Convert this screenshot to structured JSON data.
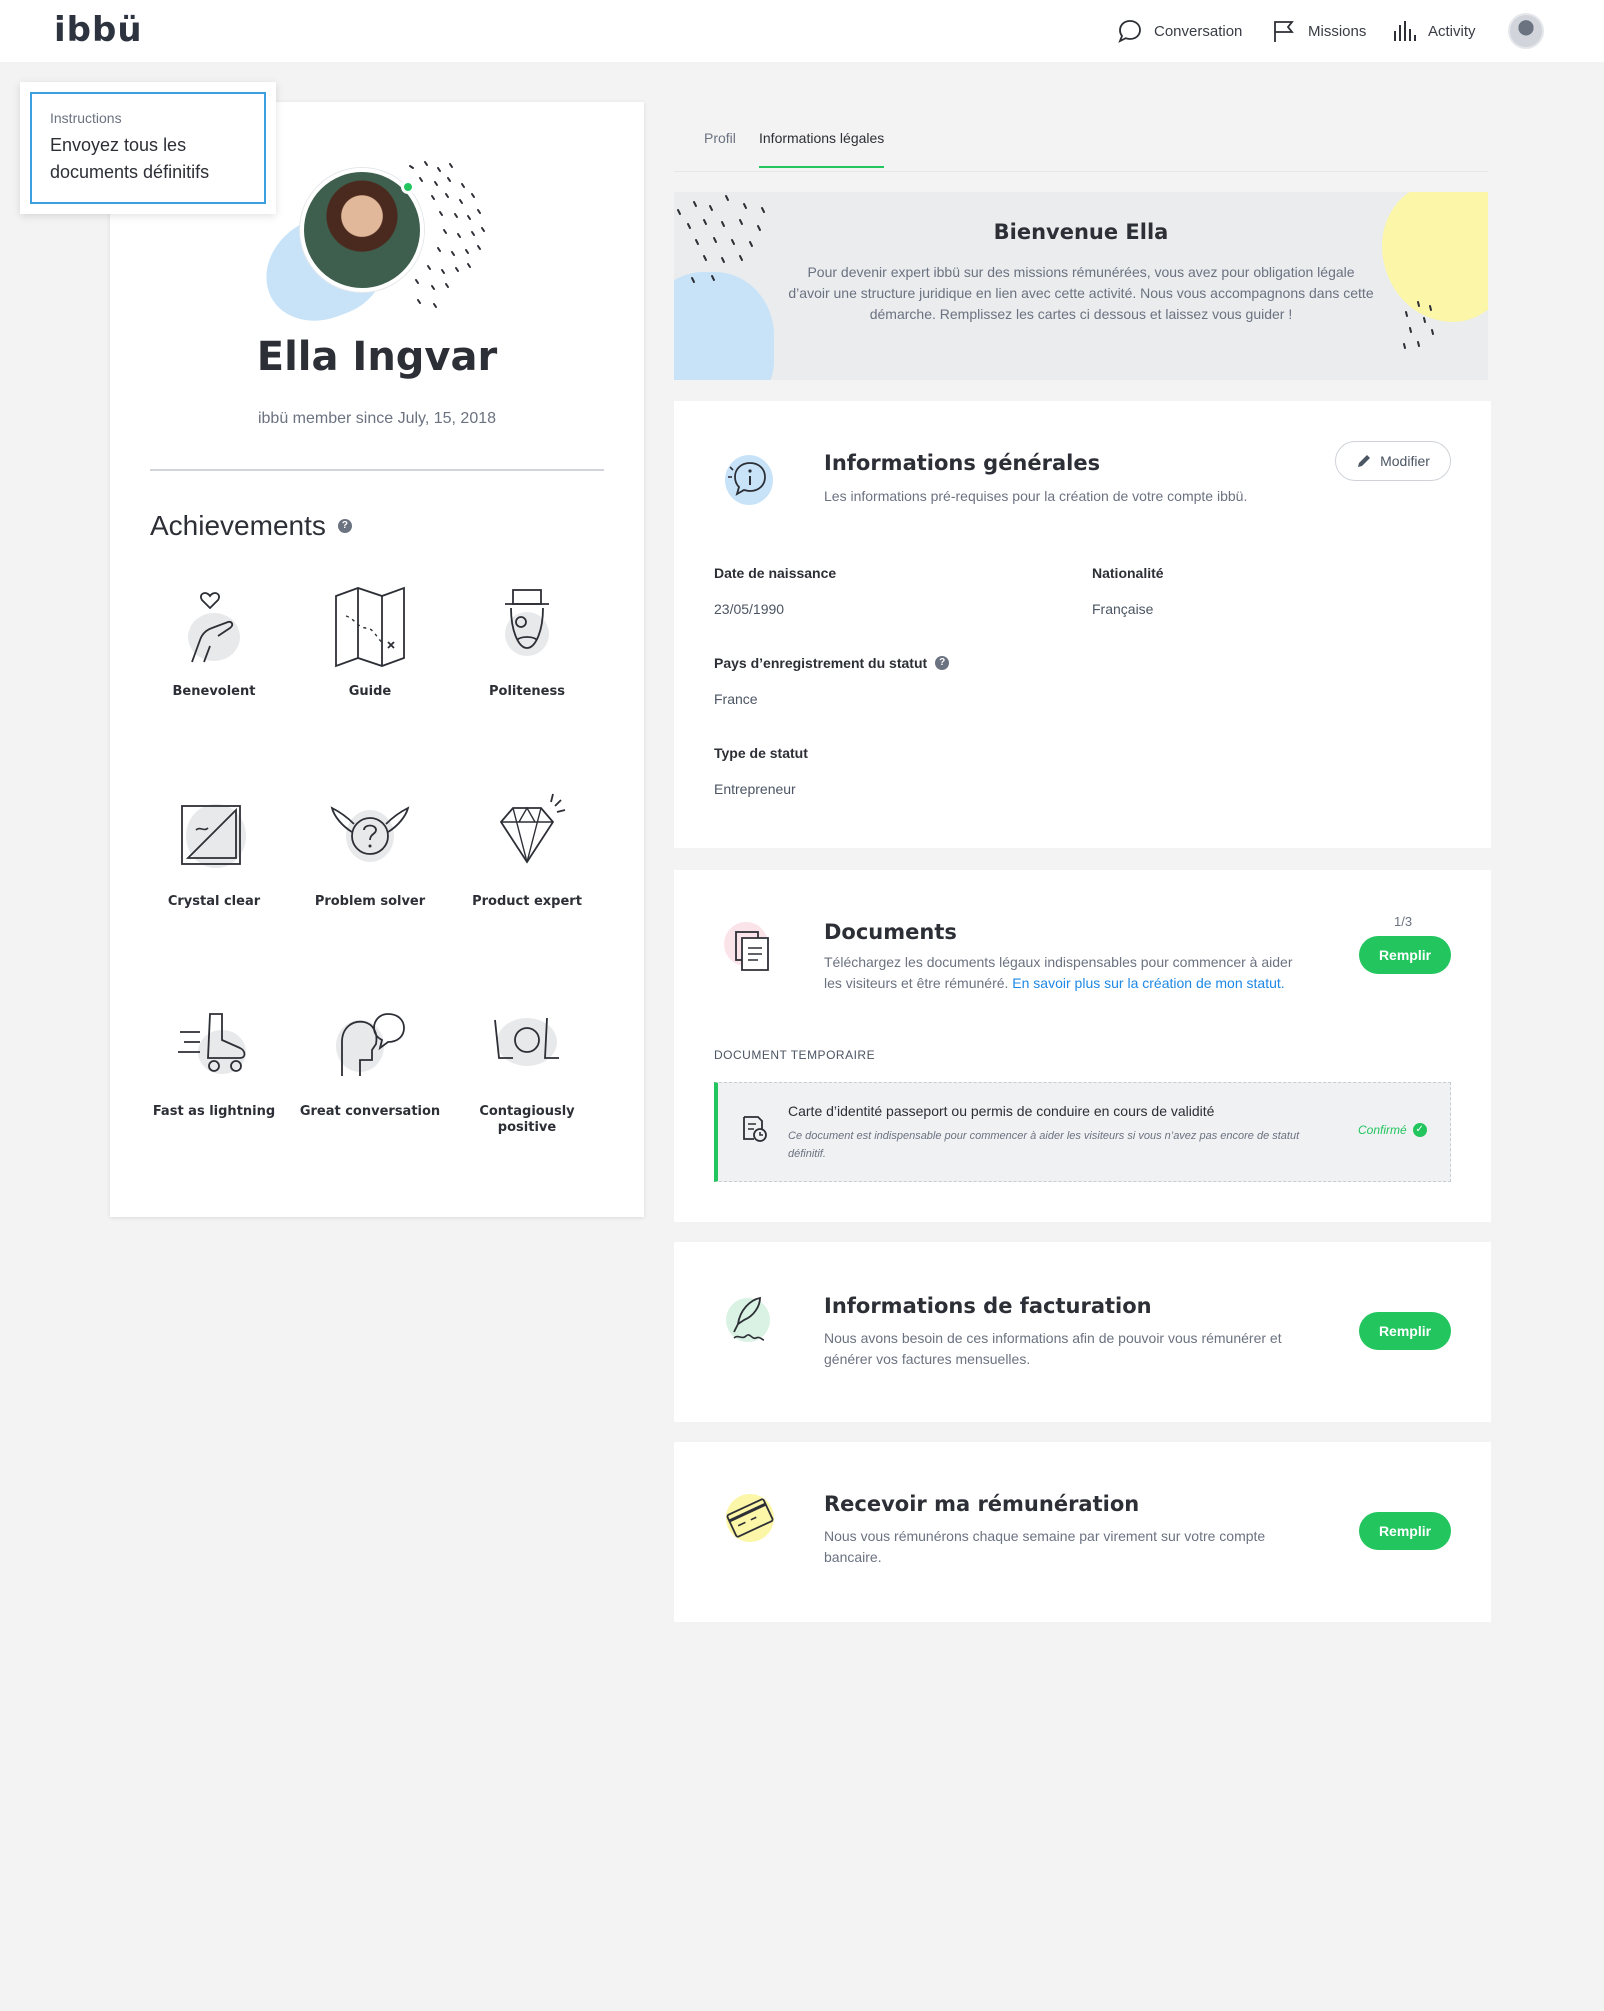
{
  "app": {
    "logo": "ibbü"
  },
  "nav": {
    "conversation": "Conversation",
    "missions": "Missions",
    "activity": "Activity"
  },
  "instructions": {
    "title": "Instructions",
    "text": "Envoyez tous les documents définitifs"
  },
  "profile": {
    "name": "Ella Ingvar",
    "since": "ibbü member since July, 15, 2018",
    "achievements_title": "Achievements",
    "achievements": [
      {
        "label": "Benevolent",
        "icon": "hand-heart-icon"
      },
      {
        "label": "Guide",
        "icon": "map-icon"
      },
      {
        "label": "Politeness",
        "icon": "gentleman-icon"
      },
      {
        "label": "Crystal clear",
        "icon": "ruler-triangle-icon"
      },
      {
        "label": "Problem solver",
        "icon": "winged-question-icon"
      },
      {
        "label": "Product expert",
        "icon": "diamond-icon"
      },
      {
        "label": "Fast as lightning",
        "icon": "roller-skate-icon"
      },
      {
        "label": "Great conversation",
        "icon": "speech-heads-icon"
      },
      {
        "label": "Contagiously positive",
        "icon": "lol-icon"
      }
    ]
  },
  "tabs": [
    {
      "label": "Profil",
      "active": false
    },
    {
      "label": "Informations légales",
      "active": true
    }
  ],
  "welcome": {
    "title": "Bienvenue Ella",
    "text": "Pour devenir expert ibbü sur des missions rémunérées, vous avez pour obligation légale d’avoir une structure juridique en lien avec cette activité. Nous vous accompagnons dans cette démarche. Remplissez les cartes ci dessous et laissez vous guider !"
  },
  "general": {
    "title": "Informations générales",
    "desc": "Les informations pré-requises pour la création de votre compte ibbü.",
    "edit_label": "Modifier",
    "fields": {
      "birth_label": "Date de naissance",
      "birth_value": "23/05/1990",
      "nationality_label": "Nationalité",
      "nationality_value": "Française",
      "country_label": "Pays d’enregistrement du statut",
      "country_value": "France",
      "status_label": "Type de statut",
      "status_value": "Entrepreneur"
    }
  },
  "documents": {
    "title": "Documents",
    "desc": "Téléchargez les documents légaux indispensables pour commencer à aider les visiteurs et être rémunéré.",
    "link": "En savoir plus sur la création de mon statut.",
    "counter": "1/3",
    "button": "Remplir",
    "section": "DOCUMENT TEMPORAIRE",
    "item": {
      "title": "Carte d’identité passeport ou permis de conduire en cours de validité",
      "desc": "Ce document est indispensable pour commencer à aider les visiteurs si vous n’avez pas encore de statut définitif.",
      "status": "Confirmé"
    }
  },
  "billing": {
    "title": "Informations de facturation",
    "desc": "Nous avons besoin de ces informations afin de pouvoir vous rémunérer et générer vos factures mensuelles.",
    "button": "Remplir"
  },
  "payment": {
    "title": "Recevoir ma rémunération",
    "desc": "Nous vous rémunérons chaque semaine par virement sur votre compte bancaire.",
    "button": "Remplir"
  },
  "colors": {
    "accent": "#22c55e",
    "link": "#1e88e5",
    "blue_blob": "#c8e3f8",
    "yellow_blob": "#fbf6a8"
  }
}
